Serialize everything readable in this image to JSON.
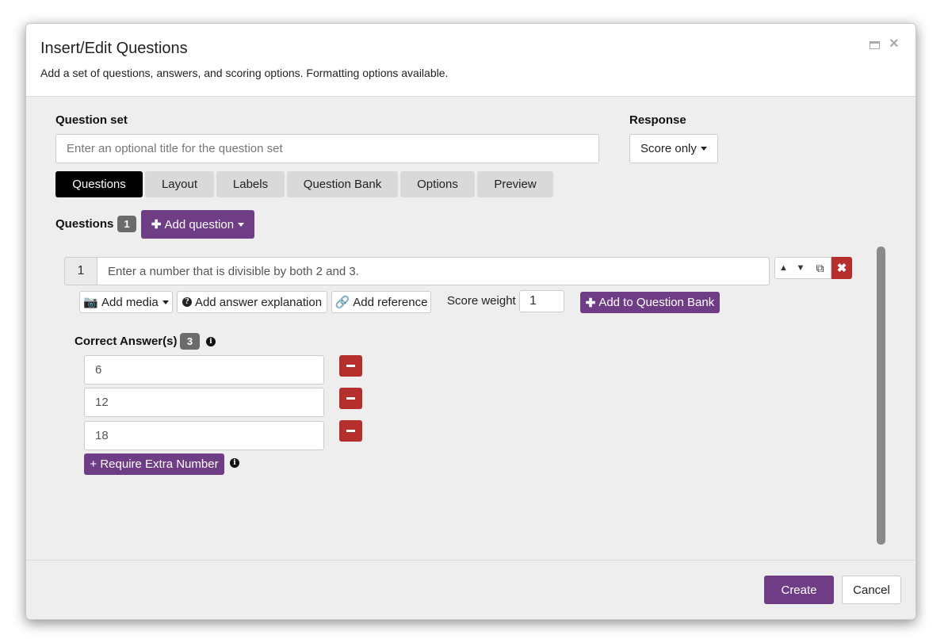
{
  "header": {
    "title": "Insert/Edit Questions",
    "subtitle": "Add a set of questions, answers, and scoring options. Formatting options available."
  },
  "question_set": {
    "label": "Question set",
    "placeholder": "Enter an optional title for the question set"
  },
  "response": {
    "label": "Response",
    "selected": "Score only"
  },
  "tabs": [
    {
      "label": "Questions",
      "active": true
    },
    {
      "label": "Layout",
      "active": false
    },
    {
      "label": "Labels",
      "active": false
    },
    {
      "label": "Question Bank",
      "active": false
    },
    {
      "label": "Options",
      "active": false
    },
    {
      "label": "Preview",
      "active": false
    }
  ],
  "questions": {
    "label": "Questions",
    "count": "1",
    "add_button": "Add question"
  },
  "question": {
    "number": "1",
    "text": "Enter a number that is divisible by both 2 and 3.",
    "add_media": "Add media",
    "add_explanation": "Add answer explanation",
    "add_reference": "Add reference",
    "score_weight_label": "Score weight",
    "score_weight": "1",
    "add_to_bank": "Add to Question Bank"
  },
  "answers": {
    "label": "Correct Answer(s)",
    "count": "3",
    "items": [
      "6",
      "12",
      "18"
    ],
    "extra_button": "+ Require Extra Number"
  },
  "footer": {
    "create": "Create",
    "cancel": "Cancel"
  },
  "colors": {
    "accent_purple": "#6f3d86",
    "danger_red": "#b52f2f",
    "active_tab": "#000000"
  },
  "icons": [
    "maximize-icon",
    "close-icon",
    "plus-icon",
    "camera-icon",
    "question-circle-icon",
    "link-icon",
    "arrow-up-icon",
    "arrow-down-icon",
    "copy-icon",
    "delete-icon",
    "minus-icon",
    "info-icon"
  ]
}
